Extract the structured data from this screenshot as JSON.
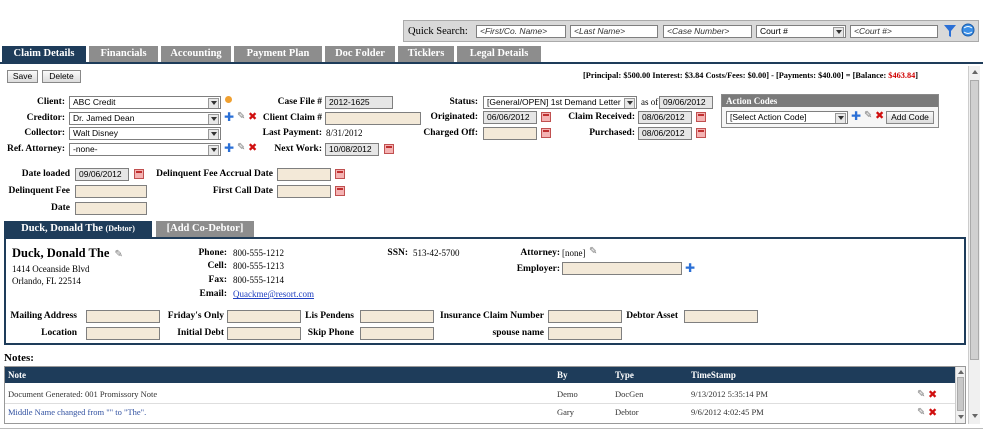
{
  "quick_search": {
    "label": "Quick Search:",
    "first_name_placeholder": "<First/Co. Name>",
    "last_name_placeholder": "<Last Name>",
    "case_number_placeholder": "<Case Number>",
    "court_select": "Court #",
    "court_placeholder": "<Court #>"
  },
  "tabs": [
    "Claim Details",
    "Financials",
    "Accounting",
    "Payment Plan",
    "Doc Folder",
    "Ticklers",
    "Legal Details"
  ],
  "toolbar": {
    "save": "Save",
    "delete": "Delete",
    "summary_prefix": "[Principal: $500.00 Interest: $3.84 Costs/Fees: $0.00] - [Payments: $40.00] = [Balance: ",
    "balance": "$463.84",
    "summary_suffix": "]"
  },
  "claim": {
    "client_label": "Client:",
    "client": "ABC Credit",
    "creditor_label": "Creditor:",
    "creditor": "Dr. Jamed Dean",
    "collector_label": "Collector:",
    "collector": "Walt Disney",
    "ref_attorney_label": "Ref. Attorney:",
    "ref_attorney": "-none-",
    "case_file_label": "Case File #",
    "case_file": "2012-1625",
    "client_claim_label": "Client Claim #",
    "client_claim": "",
    "last_payment_label": "Last Payment:",
    "last_payment": "8/31/2012",
    "next_work_label": "Next Work:",
    "next_work": "10/08/2012",
    "status_label": "Status:",
    "status": "[General/OPEN] 1st Demand Letter",
    "as_of_label": "as of",
    "as_of": "09/06/2012",
    "originated_label": "Originated:",
    "originated": "06/06/2012",
    "charged_off_label": "Charged Off:",
    "charged_off": "",
    "claim_received_label": "Claim Received:",
    "claim_received": "08/06/2012",
    "purchased_label": "Purchased:",
    "purchased": "08/06/2012",
    "date_loaded_label": "Date loaded",
    "date_loaded": "09/06/2012",
    "delinquent_fee_accrual_label": "Delinquent Fee Accrual Date",
    "delinquent_fee_label": "Delinquent Fee",
    "first_call_date_label": "First Call Date",
    "date_label": "Date"
  },
  "action_codes": {
    "title": "Action Codes",
    "select": "[Select Action Code]",
    "add_button": "Add Code"
  },
  "debtor_tabs": {
    "primary": "Duck, Donald The",
    "primary_suffix": "(Debtor)",
    "add": "[Add Co-Debtor]"
  },
  "debtor": {
    "name": "Duck, Donald The",
    "address1": "1414 Oceanside Blvd",
    "address2": "Orlando, FL 22514",
    "phone_label": "Phone:",
    "phone": "800-555-1212",
    "cell_label": "Cell:",
    "cell": "800-555-1213",
    "fax_label": "Fax:",
    "fax": "800-555-1214",
    "email_label": "Email:",
    "email": "Quackme@resort.com",
    "ssn_label": "SSN:",
    "ssn": "513-42-5700",
    "attorney_label": "Attorney:",
    "attorney": "[none]",
    "employer_label": "Employer:",
    "mailing_address_label": "Mailing Address",
    "location_label": "Location",
    "fridays_only_label": "Friday's Only",
    "initial_debt_label": "Initial Debt",
    "lis_pendens_label": "Lis Pendens",
    "skip_phone_label": "Skip Phone",
    "insurance_claim_label": "Insurance Claim Number",
    "spouse_name_label": "spouse name",
    "debtor_asset_label": "Debtor Asset"
  },
  "notes": {
    "title": "Notes:",
    "columns": [
      "Note",
      "By",
      "Type",
      "TimeStamp"
    ],
    "rows": [
      {
        "note": "Document Generated: 001 Promissory Note",
        "by": "Demo",
        "type": "DocGen",
        "timestamp": "9/13/2012 5:35:14 PM"
      },
      {
        "note": "Middle Name changed from \"\" to \"The\".",
        "by": "Gary",
        "type": "Debtor",
        "timestamp": "9/6/2012 4:02:45 PM"
      }
    ]
  },
  "colors": {
    "tab_active": "#1e3c5a",
    "tab_inactive": "#8d8d8d",
    "header_bar": "#1e3c5a",
    "balance_red": "#d00000",
    "input_bg": "#f3e9d8"
  }
}
